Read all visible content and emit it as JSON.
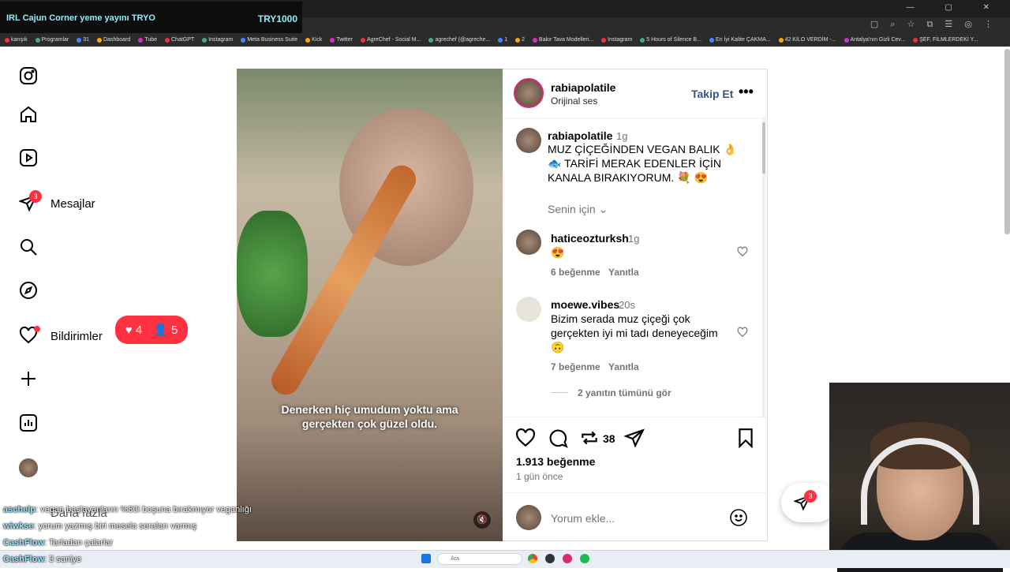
{
  "stream": {
    "title": "IRL Cajun Corner yeme yayını  TRYO",
    "goal": "TRY1000"
  },
  "bookmarks": [
    "karışık",
    "Programlar",
    "31",
    "Dashboard",
    "Tube",
    "ChatGPT",
    "Instagram",
    "Meta Business Suite",
    "Kick",
    "Twitter",
    "AgreChef - Social M...",
    "agrechef (@agreche...",
    "1",
    "2",
    "Bakır Tava Modelleri...",
    "Instagram",
    "5 Hours of Silence B...",
    "En İyi Kalite ÇAKMA...",
    "42 KİLO VERDİM -...",
    "Antalya'nın Gizli Cev...",
    "ŞEF, FİLMLERDEKİ Y..."
  ],
  "sidebar": {
    "messages_label": "Mesajlar",
    "messages_badge": "3",
    "notifications_label": "Bildirimler",
    "more_label": "Daha fazla",
    "notif_likes": "4",
    "notif_follows": "5"
  },
  "video": {
    "caption": "Denerken hiç umudum yoktu ama gerçekten çok güzel oldu."
  },
  "post": {
    "author": "rabiapolatile",
    "audio": "Orijinal ses",
    "follow_label": "Takip Et",
    "caption_user": "rabiapolatile",
    "caption_time": "1g",
    "caption_text": "MUZ ÇİÇEĞİNDEN VEGAN BALIK 👌 🐟 TARİFİ MERAK EDENLER İÇİN KANALA BIRAKIYORUM. 💐 😍",
    "for_you": "Senin için",
    "likes": "1.913 beğenme",
    "date": "1 gün önce",
    "reposts": "38",
    "comment_placeholder": "Yorum ekle..."
  },
  "comments": [
    {
      "user": "haticeozturksh",
      "time": "1g",
      "text": "😍",
      "likes": "6 beğenme",
      "reply": "Yanıtla"
    },
    {
      "user": "moewe.vibes",
      "time": "20s",
      "text": "Bizim serada muz çiçeği çok gerçekten iyi mi tadı deneyeceğim 🙃",
      "likes": "7 beğenme",
      "reply": "Yanıtla",
      "view_replies": "2 yanıtın tümünü gör"
    }
  ],
  "float_badge": "3",
  "chat": [
    {
      "user": "aschelp",
      "msg": ": vegan başlayanların %80i boşuna bırakmıyor veganlığı"
    },
    {
      "user": "wiwkse",
      "msg": ": yorum yazmış biri mesela seraları varmış"
    },
    {
      "user": "CashFlow",
      "msg": ": Tarladan çalarlar"
    },
    {
      "user": "CashFlow",
      "msg": ": 3 saniye"
    }
  ],
  "taskbar": {
    "search": "Ara"
  },
  "colors": {
    "accent": "#ff3040",
    "link": "#0095f6",
    "chrome": "#1f1f1f"
  }
}
